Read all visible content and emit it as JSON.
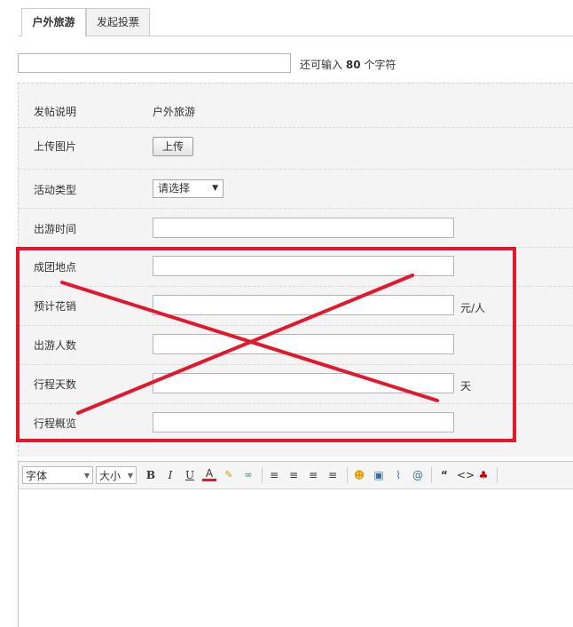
{
  "tabs": [
    {
      "label": "户外旅游",
      "active": true
    },
    {
      "label": "发起投票",
      "active": false
    }
  ],
  "subject": {
    "value": "",
    "counter_prefix": "还可输入",
    "counter_number": "80",
    "counter_suffix": "个字符"
  },
  "form": {
    "post_desc_label": "发帖说明",
    "post_desc_value": "户外旅游",
    "upload_label": "上传图片",
    "upload_button": "上传",
    "activity_type_label": "活动类型",
    "activity_type_value": "请选择",
    "travel_time_label": "出游时间",
    "meeting_place_label": "成团地点",
    "cost_label": "预计花销",
    "cost_unit": "元/人",
    "people_label": "出游人数",
    "days_label": "行程天数",
    "days_unit": "天",
    "overview_label": "行程概览"
  },
  "editor": {
    "font_select": "字体",
    "size_select": "大小",
    "icons": [
      "bold-icon",
      "italic-icon",
      "underline-icon",
      "font-color-icon",
      "highlight-icon",
      "link-icon",
      "align-justify-icon",
      "align-left-icon",
      "align-center-icon",
      "align-right-icon",
      "emoji-icon",
      "image-icon",
      "attachment-icon",
      "at-icon",
      "quote-icon",
      "code-icon",
      "qq-icon"
    ]
  },
  "colors": {
    "annotation_red": "#e3182d",
    "panel_bg": "#f4f4f4"
  }
}
